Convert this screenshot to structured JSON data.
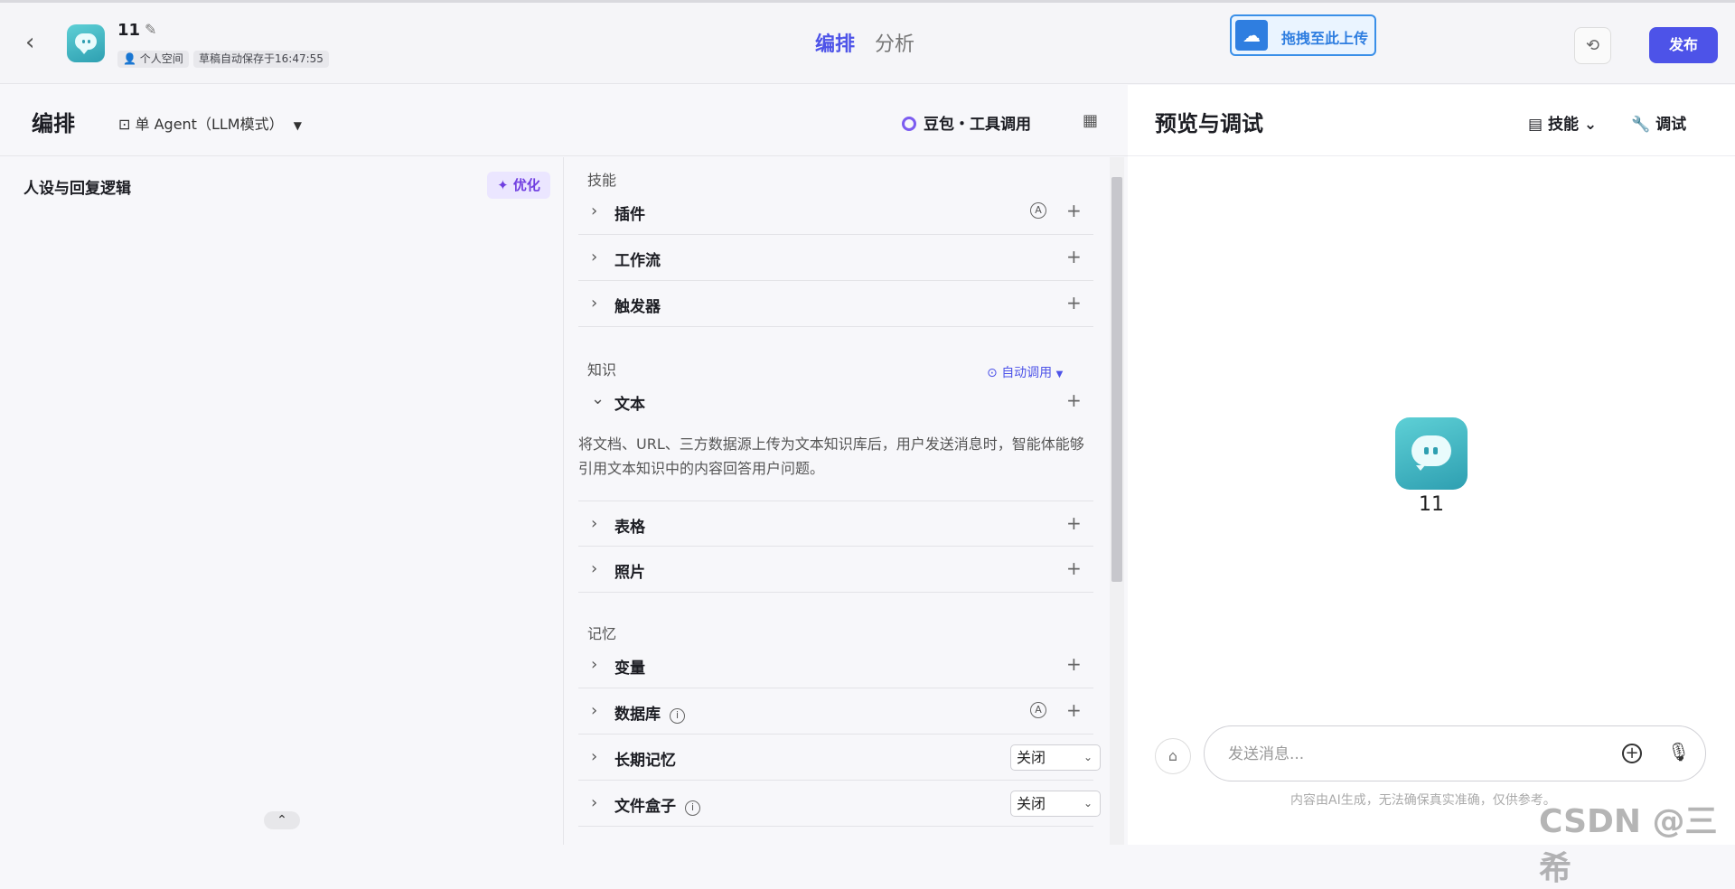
{
  "header": {
    "bot_name": "11",
    "space_label": "个人空间",
    "autosave_label": "草稿自动保存于16:47:55",
    "tabs": [
      {
        "label": "编排",
        "active": true
      },
      {
        "label": "分析",
        "active": false
      }
    ],
    "upload_label": "拖拽至此上传",
    "publish_label": "发布"
  },
  "left": {
    "title": "编排",
    "mode_label": "单 Agent（LLM模式）",
    "model_label": "豆包・工具调用",
    "persona_title": "人设与回复逻辑",
    "optimize_label": "优化"
  },
  "skills": {
    "skills_title": "技能",
    "plugin_label": "插件",
    "workflow_label": "工作流",
    "trigger_label": "触发器",
    "knowledge_title": "知识",
    "auto_call_label": "自动调用",
    "text_label": "文本",
    "text_desc": "将文档、URL、三方数据源上传为文本知识库后，用户发送消息时，智能体能够引用文本知识中的内容回答用户问题。",
    "table_label": "表格",
    "photo_label": "照片",
    "memory_title": "记忆",
    "variable_label": "变量",
    "database_label": "数据库",
    "long_memory_label": "长期记忆",
    "long_memory_value": "关闭",
    "filebox_label": "文件盒子",
    "filebox_value": "关闭"
  },
  "right": {
    "title": "预览与调试",
    "skill_btn_label": "技能",
    "debug_btn_label": "调试",
    "preview_name": "11",
    "input_placeholder": "发送消息...",
    "disclaimer": "内容由AI生成，无法确保真实准确，仅供参考。"
  },
  "watermark": "CSDN @三希",
  "colors": {
    "accent": "#4d53e8",
    "optimize_bg": "#ebe6ff",
    "avatar": "#2e9fb1",
    "annotation_arrow": "#e02020"
  }
}
